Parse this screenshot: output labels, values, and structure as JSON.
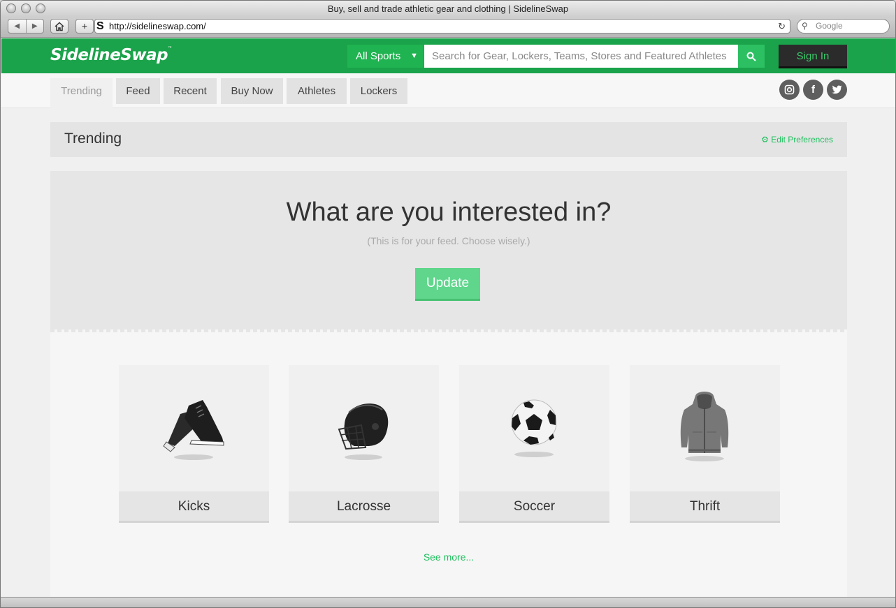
{
  "browser": {
    "window_title": "Buy, sell and trade athletic gear and clothing | SidelineSwap",
    "url": "http://sidelineswap.com/",
    "search_placeholder": "Google"
  },
  "header": {
    "logo": "SidelineSwap",
    "logo_tm": "™",
    "sport_select": "All Sports",
    "search_placeholder": "Search for Gear, Lockers, Teams, Stores and Featured Athletes",
    "signin_label": "Sign In"
  },
  "subnav": {
    "tabs": [
      {
        "label": "Trending",
        "active": true
      },
      {
        "label": "Feed"
      },
      {
        "label": "Recent"
      },
      {
        "label": "Buy Now"
      },
      {
        "label": "Athletes"
      },
      {
        "label": "Lockers"
      }
    ],
    "social": [
      "instagram-icon",
      "facebook-icon",
      "twitter-icon"
    ]
  },
  "trending": {
    "title": "Trending",
    "edit_preferences": "Edit Preferences"
  },
  "interests": {
    "question": "What are you interested in?",
    "subtitle": "(This is for your feed. Choose wisely.)",
    "update_label": "Update",
    "cards": [
      {
        "label": "Kicks",
        "icon": "sneaker-icon"
      },
      {
        "label": "Lacrosse",
        "icon": "lacrosse-helmet-icon"
      },
      {
        "label": "Soccer",
        "icon": "soccer-ball-icon"
      },
      {
        "label": "Thrift",
        "icon": "hoodie-icon"
      }
    ],
    "see_more": "See more..."
  },
  "colors": {
    "brand_green": "#1aa34a",
    "accent_green": "#1fbf5e",
    "update_green": "#5fd68c"
  }
}
